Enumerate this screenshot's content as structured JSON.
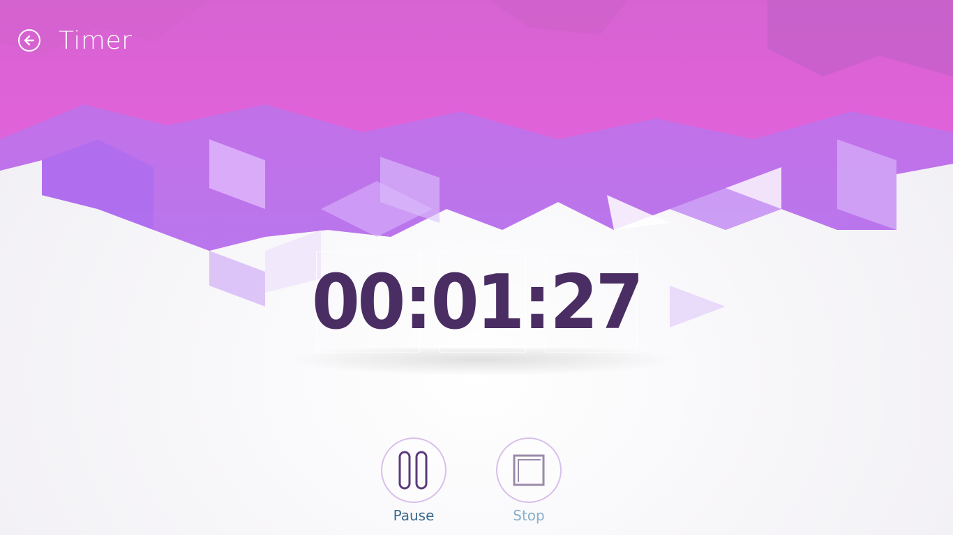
{
  "header": {
    "title": "Timer"
  },
  "timer": {
    "hours": "00",
    "minutes": "01",
    "seconds": "27",
    "separator": ":",
    "digit_color": "#4a2d63"
  },
  "controls": {
    "pause_label": "Pause",
    "stop_label": "Stop"
  },
  "icons": {
    "back": "back-arrow-icon",
    "pause": "pause-icon",
    "stop": "stop-icon"
  },
  "theme": {
    "accent_pink": "#e562d6",
    "accent_purple": "#b97cf2",
    "background": "#f4f3f6"
  }
}
